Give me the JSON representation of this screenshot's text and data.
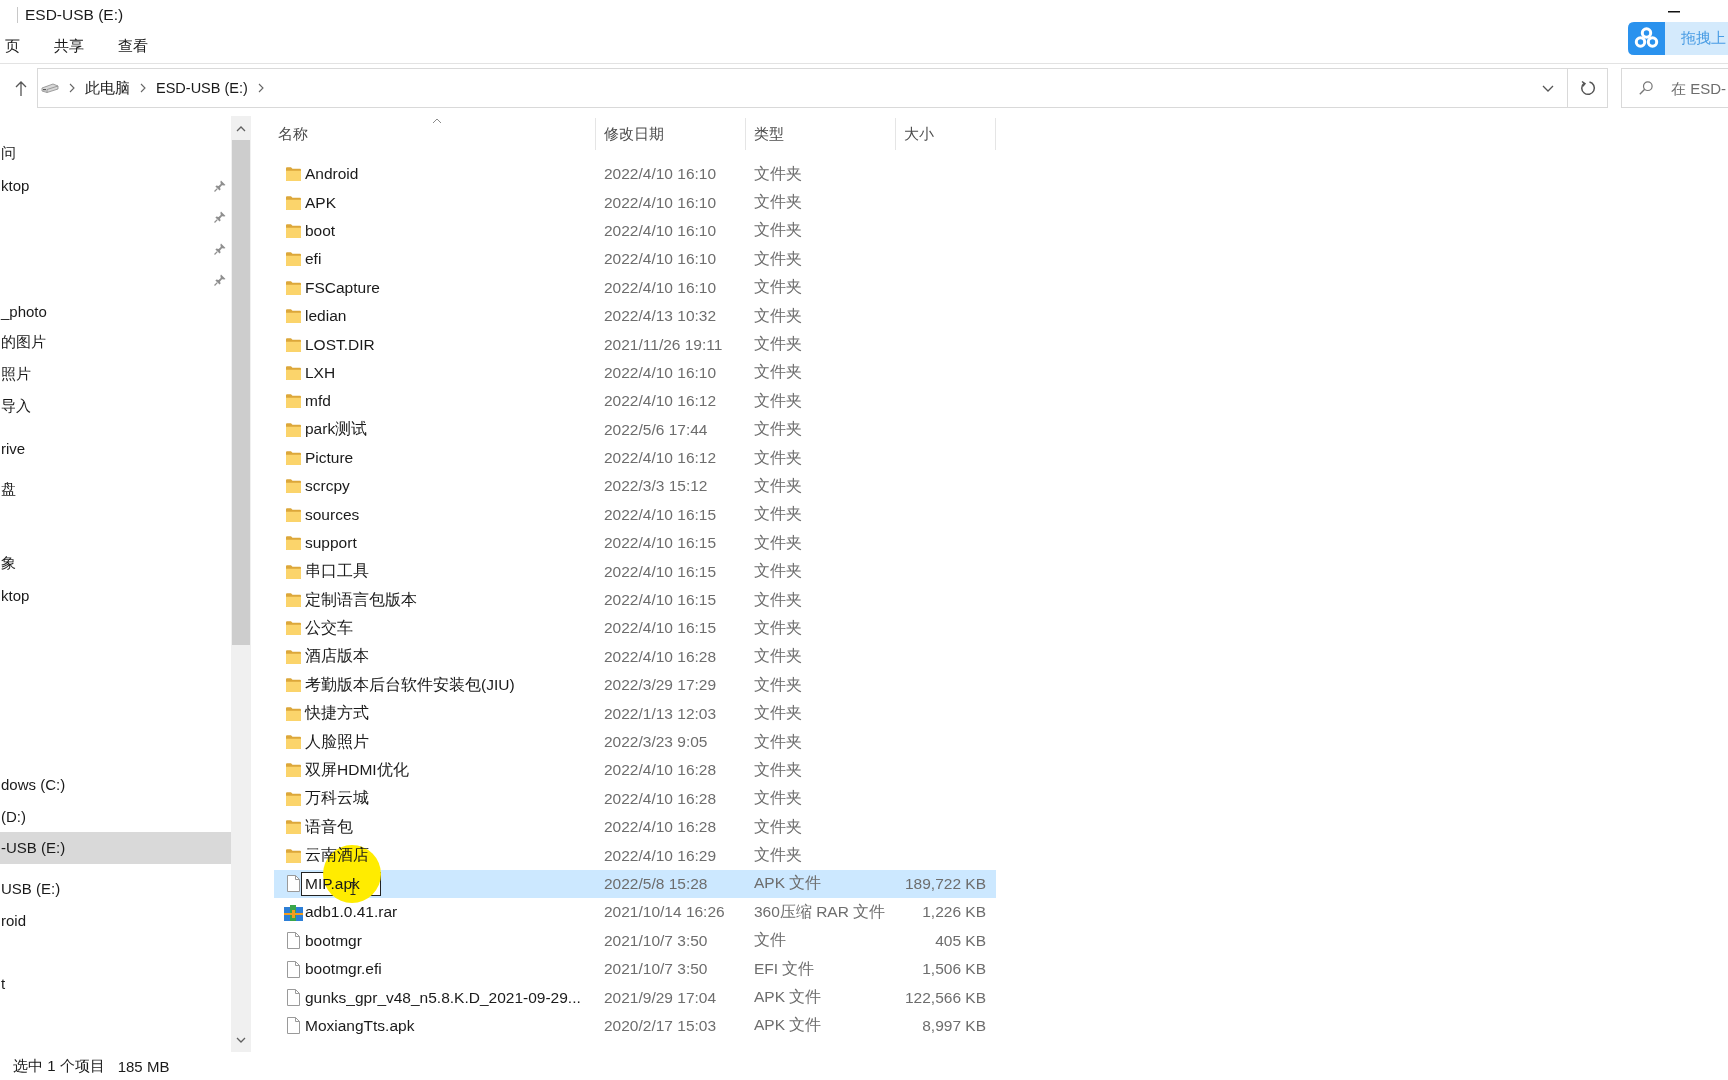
{
  "window": {
    "title": "ESD-USB (E:)"
  },
  "ribbon_tabs": [
    "页",
    "共享",
    "查看"
  ],
  "upload_widget": {
    "label": "拖拽上"
  },
  "address_bar": {
    "path": [
      "此电脑",
      "ESD-USB (E:)"
    ]
  },
  "search": {
    "placeholder": "在 ESD-"
  },
  "sidebar": {
    "items": [
      {
        "label": "问",
        "pinned": false,
        "selected": false
      },
      {
        "label": "ktop",
        "pinned": true,
        "selected": false
      },
      {
        "pinned": true,
        "selected": false
      },
      {
        "pinned": true,
        "selected": false
      },
      {
        "pinned": true,
        "selected": false
      },
      {
        "label": "_photo",
        "pinned": false,
        "selected": false
      },
      {
        "label": "的图片",
        "pinned": false,
        "selected": false
      },
      {
        "label": "照片",
        "pinned": false,
        "selected": false
      },
      {
        "label": "导入",
        "pinned": false,
        "selected": false
      },
      {
        "label": "rive",
        "pinned": false,
        "selected": false
      },
      {
        "label": "盘",
        "pinned": false,
        "selected": false
      },
      {
        "label": "象",
        "pinned": false,
        "selected": false
      },
      {
        "label": "ktop",
        "pinned": false,
        "selected": false
      },
      {
        "label": "dows (C:)",
        "pinned": false,
        "selected": false
      },
      {
        "label": "(D:)",
        "pinned": false,
        "selected": false
      },
      {
        "label": "-USB (E:)",
        "pinned": false,
        "selected": true
      },
      {
        "label": "USB (E:)",
        "pinned": false,
        "selected": false
      },
      {
        "label": "roid",
        "pinned": false,
        "selected": false
      },
      {
        "label": "t",
        "pinned": false,
        "selected": false
      }
    ]
  },
  "file_list": {
    "columns": [
      {
        "label": "名称",
        "sorted": true
      },
      {
        "label": "修改日期",
        "sorted": false
      },
      {
        "label": "类型",
        "sorted": false
      },
      {
        "label": "大小",
        "sorted": false
      }
    ],
    "rows": [
      {
        "kind": "folder",
        "name": "Android",
        "modified": "2022/4/10 16:10",
        "type": "文件夹",
        "selected": false,
        "renaming": false
      },
      {
        "kind": "folder",
        "name": "APK",
        "modified": "2022/4/10 16:10",
        "type": "文件夹",
        "selected": false,
        "renaming": false
      },
      {
        "kind": "folder",
        "name": "boot",
        "modified": "2022/4/10 16:10",
        "type": "文件夹",
        "selected": false,
        "renaming": false
      },
      {
        "kind": "folder",
        "name": "efi",
        "modified": "2022/4/10 16:10",
        "type": "文件夹",
        "selected": false,
        "renaming": false
      },
      {
        "kind": "folder",
        "name": "FSCapture",
        "modified": "2022/4/10 16:10",
        "type": "文件夹",
        "selected": false,
        "renaming": false
      },
      {
        "kind": "folder",
        "name": "ledian",
        "modified": "2022/4/13 10:32",
        "type": "文件夹",
        "selected": false,
        "renaming": false
      },
      {
        "kind": "folder",
        "name": "LOST.DIR",
        "modified": "2021/11/26 19:11",
        "type": "文件夹",
        "selected": false,
        "renaming": false
      },
      {
        "kind": "folder",
        "name": "LXH",
        "modified": "2022/4/10 16:10",
        "type": "文件夹",
        "selected": false,
        "renaming": false
      },
      {
        "kind": "folder",
        "name": "mfd",
        "modified": "2022/4/10 16:12",
        "type": "文件夹",
        "selected": false,
        "renaming": false
      },
      {
        "kind": "folder",
        "name": "park测试",
        "modified": "2022/5/6 17:44",
        "type": "文件夹",
        "selected": false,
        "renaming": false
      },
      {
        "kind": "folder",
        "name": "Picture",
        "modified": "2022/4/10 16:12",
        "type": "文件夹",
        "selected": false,
        "renaming": false
      },
      {
        "kind": "folder",
        "name": "scrcpy",
        "modified": "2022/3/3 15:12",
        "type": "文件夹",
        "selected": false,
        "renaming": false
      },
      {
        "kind": "folder",
        "name": "sources",
        "modified": "2022/4/10 16:15",
        "type": "文件夹",
        "selected": false,
        "renaming": false
      },
      {
        "kind": "folder",
        "name": "support",
        "modified": "2022/4/10 16:15",
        "type": "文件夹",
        "selected": false,
        "renaming": false
      },
      {
        "kind": "folder",
        "name": "串口工具",
        "modified": "2022/4/10 16:15",
        "type": "文件夹",
        "selected": false,
        "renaming": false
      },
      {
        "kind": "folder",
        "name": "定制语言包版本",
        "modified": "2022/4/10 16:15",
        "type": "文件夹",
        "selected": false,
        "renaming": false
      },
      {
        "kind": "folder",
        "name": "公交车",
        "modified": "2022/4/10 16:15",
        "type": "文件夹",
        "selected": false,
        "renaming": false
      },
      {
        "kind": "folder",
        "name": "酒店版本",
        "modified": "2022/4/10 16:28",
        "type": "文件夹",
        "selected": false,
        "renaming": false
      },
      {
        "kind": "folder",
        "name": "考勤版本后台软件安装包(JIU)",
        "modified": "2022/3/29 17:29",
        "type": "文件夹",
        "selected": false,
        "renaming": false
      },
      {
        "kind": "folder",
        "name": "快捷方式",
        "modified": "2022/1/13 12:03",
        "type": "文件夹",
        "selected": false,
        "renaming": false
      },
      {
        "kind": "folder",
        "name": "人脸照片",
        "modified": "2022/3/23 9:05",
        "type": "文件夹",
        "selected": false,
        "renaming": false
      },
      {
        "kind": "folder",
        "name": "双屏HDMI优化",
        "modified": "2022/4/10 16:28",
        "type": "文件夹",
        "selected": false,
        "renaming": false
      },
      {
        "kind": "folder",
        "name": "万科云城",
        "modified": "2022/4/10 16:28",
        "type": "文件夹",
        "selected": false,
        "renaming": false
      },
      {
        "kind": "folder",
        "name": "语音包",
        "modified": "2022/4/10 16:28",
        "type": "文件夹",
        "selected": false,
        "renaming": false
      },
      {
        "kind": "folder",
        "name": "云南酒店",
        "modified": "2022/4/10 16:29",
        "type": "文件夹",
        "selected": false,
        "renaming": false
      },
      {
        "kind": "file",
        "name": "MIP.apk",
        "modified": "2022/5/8 15:28",
        "type": "APK 文件",
        "size": "189,722 KB",
        "selected": true,
        "renaming": true
      },
      {
        "kind": "archive",
        "name": "adb1.0.41.rar",
        "modified": "2021/10/14 16:26",
        "type": "360压缩 RAR 文件",
        "size": "1,226 KB",
        "selected": false,
        "renaming": false
      },
      {
        "kind": "file",
        "name": "bootmgr",
        "modified": "2021/10/7 3:50",
        "type": "文件",
        "size": "405 KB",
        "selected": false,
        "renaming": false
      },
      {
        "kind": "file",
        "name": "bootmgr.efi",
        "modified": "2021/10/7 3:50",
        "type": "EFI 文件",
        "size": "1,506 KB",
        "selected": false,
        "renaming": false
      },
      {
        "kind": "file",
        "name": "gunks_gpr_v48_n5.8.K.D_2021-09-29...",
        "modified": "2021/9/29 17:04",
        "type": "APK 文件",
        "size": "122,566 KB",
        "selected": false,
        "renaming": false
      },
      {
        "kind": "file",
        "name": "MoxiangTts.apk",
        "modified": "2020/2/17 15:03",
        "type": "APK 文件",
        "size": "8,997 KB",
        "selected": false,
        "renaming": false
      }
    ]
  },
  "status_bar": {
    "selection": "选中 1 个项目",
    "size": "185 MB"
  }
}
